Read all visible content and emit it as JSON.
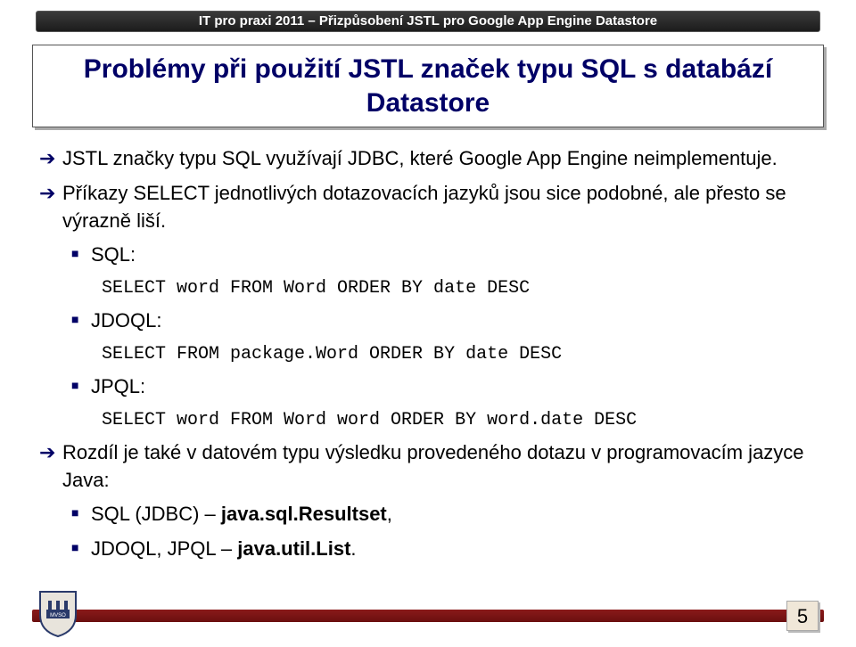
{
  "header": "IT pro praxi 2011 – Přizpůsobení JSTL pro Google App Engine Datastore",
  "title": "Problémy při použití JSTL značek typu SQL s databází Datastore",
  "bullets": {
    "b1": "JSTL značky typu SQL využívají JDBC, které Google App Engine neimplementuje.",
    "b2": "Příkazy SELECT jednotlivých dotazovacích jazyků jsou sice podobné, ale přesto se výrazně liší.",
    "sql_label": "SQL:",
    "sql_code": "SELECT word FROM Word ORDER BY date DESC",
    "jdoql_label": "JDOQL:",
    "jdoql_code": "SELECT FROM package.Word ORDER BY date DESC",
    "jpql_label": "JPQL:",
    "jpql_code": "SELECT word FROM Word word ORDER BY word.date DESC",
    "b3": "Rozdíl je také v datovém typu výsledku provedeného dotazu v programovacím jazyce Java:",
    "r1_a": "SQL (JDBC) – ",
    "r1_b": "java.sql.Resultset",
    "r1_c": ",",
    "r2_a": "JDOQL, JPQL – ",
    "r2_b": "java.util.List",
    "r2_c": "."
  },
  "page_number": "5"
}
